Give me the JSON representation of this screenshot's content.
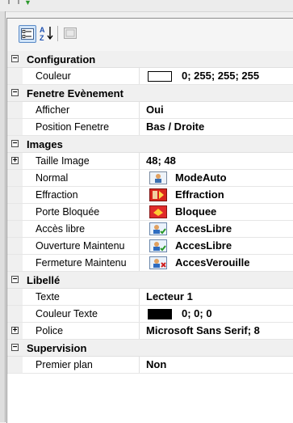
{
  "toolbar": {
    "buttons": [
      {
        "name": "categorized-view-button",
        "icon": "categorized-icon"
      },
      {
        "name": "alphabetical-sort-button",
        "icon": "sort-az-icon"
      },
      {
        "name": "property-pages-button",
        "icon": "property-pages-icon"
      }
    ]
  },
  "colors": {
    "accent": "#5a8ac6",
    "swatch_white": "#ffffff",
    "swatch_black": "#000000"
  },
  "grid": {
    "configuration": {
      "label": "Configuration",
      "couleur": {
        "name": "Couleur",
        "value": "0; 255; 255; 255"
      }
    },
    "fenetre": {
      "label": "Fenetre Evènement",
      "afficher": {
        "name": "Afficher",
        "value": "Oui"
      },
      "position": {
        "name": "Position Fenetre",
        "value": "Bas / Droite"
      }
    },
    "images": {
      "label": "Images",
      "taille": {
        "name": "Taille Image",
        "value": "48; 48"
      },
      "normal": {
        "name": "Normal",
        "value": "ModeAuto",
        "icon": "mode-auto-icon"
      },
      "effraction": {
        "name": "Effraction",
        "value": "Effraction",
        "icon": "effraction-icon"
      },
      "porte": {
        "name": "Porte Bloquée",
        "value": "Bloquee",
        "icon": "bloquee-icon"
      },
      "acces": {
        "name": "Accès libre",
        "value": "AccesLibre",
        "icon": "acces-libre-icon"
      },
      "ouverture": {
        "name": "Ouverture Maintenu",
        "value": "AccesLibre",
        "icon": "acces-libre-icon"
      },
      "fermeture": {
        "name": "Fermeture Maintenu",
        "value": "AccesVerouille",
        "icon": "acces-verrouille-icon"
      }
    },
    "libelle": {
      "label": "Libellé",
      "texte": {
        "name": "Texte",
        "value": "Lecteur 1"
      },
      "couleur_texte": {
        "name": "Couleur Texte",
        "value": "0; 0; 0"
      },
      "police": {
        "name": "Police",
        "value": "Microsoft Sans Serif; 8"
      }
    },
    "supervision": {
      "label": "Supervision",
      "premier_plan": {
        "name": "Premier plan",
        "value": "Non"
      }
    }
  }
}
